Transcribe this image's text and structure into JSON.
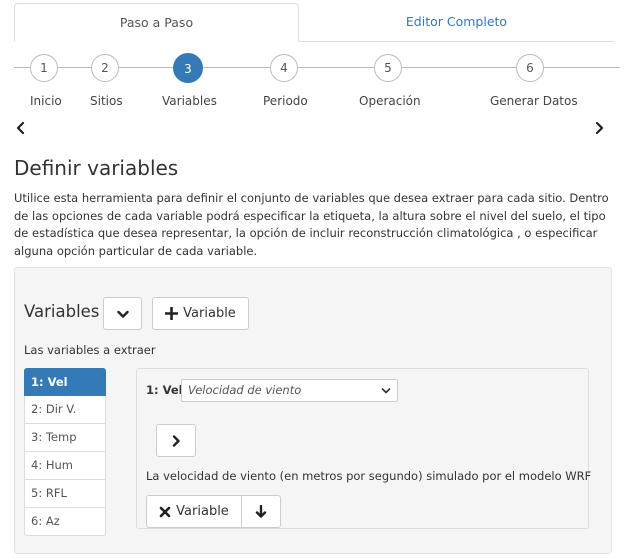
{
  "tabs": [
    {
      "label": "Paso a Paso",
      "active": true
    },
    {
      "label": "Editor Completo",
      "active": false
    }
  ],
  "stepper": {
    "steps": [
      {
        "num": "1",
        "label": "Inicio"
      },
      {
        "num": "2",
        "label": "Sitios"
      },
      {
        "num": "3",
        "label": "Variables"
      },
      {
        "num": "4",
        "label": "Periodo"
      },
      {
        "num": "5",
        "label": "Operación"
      },
      {
        "num": "6",
        "label": "Generar Datos"
      }
    ],
    "active_step": 3
  },
  "section": {
    "title": "Definir variables",
    "description": "Utilice esta herramienta para definir el conjunto de variables que desea extraer para cada sitio. Dentro de las opciones de cada variable podrá especificar la etiqueta, la altura sobre el nivel del suelo, el tipo de estadística que desea representar, la opción de incluir reconstrucción climatológica , o especificar alguna opción particular de cada variable."
  },
  "variables_panel": {
    "title": "Variables",
    "add_label": "Variable",
    "subtitle": "Las variables a extraer",
    "items": [
      "1: Vel",
      "2: Dir V.",
      "3: Temp",
      "4: Hum",
      "5: RFL",
      "6: Az"
    ],
    "active_index": 0
  },
  "detail": {
    "var_id": "1: Vel",
    "select_value": "Velocidad de viento",
    "description": "La velocidad de viento (en metros por segundo) simulado por el modelo WRF",
    "remove_label": "Variable"
  },
  "colors": {
    "primary": "#337ab7",
    "border": "#dddddd",
    "panel_bg": "#f5f5f5"
  }
}
